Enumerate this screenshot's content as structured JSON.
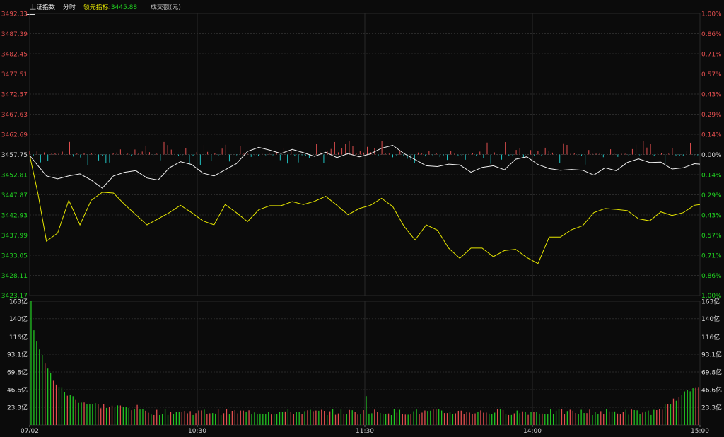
{
  "header": {
    "title": "上证指数",
    "period": "分时",
    "lead_label": "领先指标:",
    "lead_value": "3445.88",
    "volume_label": "成交额(元)"
  },
  "colors": {
    "background": "#0b0b0b",
    "grid": "#2a2a2a",
    "up": "#e34f4f",
    "down": "#21c4c4",
    "price_line": "#f0f0f0",
    "lead_line": "#e6e600",
    "vol_up": "#e34f4f",
    "vol_down": "#22c422",
    "axis_up_text": "#e34f4f",
    "axis_down_text": "#21d321",
    "axis_neutral_text": "#dddddd"
  },
  "chart_data": {
    "type": "line",
    "base_price": 3457.75,
    "price_axis": {
      "labels": [
        "3492.33",
        "3487.39",
        "3482.45",
        "3477.51",
        "3472.57",
        "3467.63",
        "3462.69",
        "3457.75",
        "3452.81",
        "3447.87",
        "3442.93",
        "3437.99",
        "3433.05",
        "3428.11",
        "3423.17"
      ],
      "ylim": [
        3423.17,
        3492.33
      ]
    },
    "pct_axis": {
      "labels": [
        "1.00%",
        "0.86%",
        "0.71%",
        "0.57%",
        "0.43%",
        "0.29%",
        "0.14%",
        "0.00%",
        "0.14%",
        "0.29%",
        "0.43%",
        "0.57%",
        "0.71%",
        "0.86%",
        "1.00%"
      ]
    },
    "volume_axis": {
      "labels": [
        "163亿",
        "140亿",
        "116亿",
        "93.1亿",
        "69.8亿",
        "46.6亿",
        "23.3亿"
      ],
      "ylim": [
        0,
        163
      ]
    },
    "x_labels": [
      "07/02",
      "10:30",
      "11:30",
      "14:00",
      "15:00"
    ],
    "x_label_minutes": [
      0,
      60,
      120,
      180,
      240
    ],
    "series": [
      {
        "key": "price",
        "x": [
          0,
          3,
          6,
          10,
          14,
          18,
          22,
          26,
          30,
          34,
          38,
          42,
          46,
          50,
          54,
          58,
          62,
          66,
          70,
          74,
          78,
          82,
          86,
          90,
          94,
          98,
          102,
          106,
          110,
          114,
          118,
          122,
          126,
          130,
          134,
          138,
          142,
          146,
          150,
          154,
          158,
          162,
          166,
          170,
          174,
          178,
          182,
          186,
          190,
          194,
          198,
          202,
          206,
          210,
          214,
          218,
          222,
          226,
          230,
          234,
          238,
          240
        ],
        "values": [
          3457.5,
          3455.0,
          3452.5,
          3451.8,
          3452.5,
          3453.0,
          3451.5,
          3449.5,
          3452.5,
          3453.4,
          3453.8,
          3452.0,
          3451.5,
          3454.5,
          3456.0,
          3455.3,
          3453.2,
          3452.5,
          3454.0,
          3455.5,
          3458.5,
          3459.5,
          3458.8,
          3458.0,
          3459.0,
          3458.2,
          3457.3,
          3458.3,
          3457.0,
          3458.0,
          3457.2,
          3457.9,
          3459.3,
          3460.0,
          3458.0,
          3456.5,
          3455.0,
          3454.8,
          3455.4,
          3455.2,
          3453.4,
          3454.6,
          3455.0,
          3454.0,
          3456.6,
          3457.2,
          3455.3,
          3454.3,
          3453.9,
          3454.1,
          3453.9,
          3452.7,
          3454.5,
          3453.8,
          3455.8,
          3456.7,
          3455.8,
          3455.9,
          3454.2,
          3454.5,
          3455.5,
          3455.4
        ]
      },
      {
        "key": "lead",
        "x": [
          0,
          3,
          6,
          10,
          14,
          18,
          22,
          26,
          30,
          34,
          38,
          42,
          46,
          50,
          54,
          58,
          62,
          66,
          70,
          74,
          78,
          82,
          86,
          90,
          94,
          98,
          102,
          106,
          110,
          114,
          118,
          122,
          126,
          130,
          134,
          138,
          142,
          146,
          150,
          154,
          158,
          162,
          166,
          170,
          174,
          178,
          182,
          186,
          190,
          194,
          198,
          202,
          206,
          210,
          214,
          218,
          222,
          226,
          230,
          234,
          238,
          240
        ],
        "values": [
          3457.5,
          3448.0,
          3436.5,
          3438.5,
          3446.5,
          3440.5,
          3446.5,
          3448.5,
          3448.3,
          3445.5,
          3443.0,
          3440.5,
          3442.0,
          3443.5,
          3445.3,
          3443.5,
          3441.5,
          3440.5,
          3445.5,
          3443.5,
          3441.3,
          3444.2,
          3445.2,
          3445.2,
          3446.2,
          3445.5,
          3446.3,
          3447.5,
          3445.3,
          3443.0,
          3444.5,
          3445.3,
          3447.0,
          3445.0,
          3440.2,
          3436.8,
          3440.5,
          3439.2,
          3434.8,
          3432.3,
          3434.8,
          3434.8,
          3432.7,
          3434.2,
          3434.5,
          3432.5,
          3431.0,
          3437.5,
          3437.5,
          3439.3,
          3440.3,
          3443.5,
          3444.5,
          3444.3,
          3444.0,
          3442.0,
          3441.5,
          3443.7,
          3442.8,
          3443.5,
          3445.3,
          3445.5
        ]
      }
    ]
  }
}
